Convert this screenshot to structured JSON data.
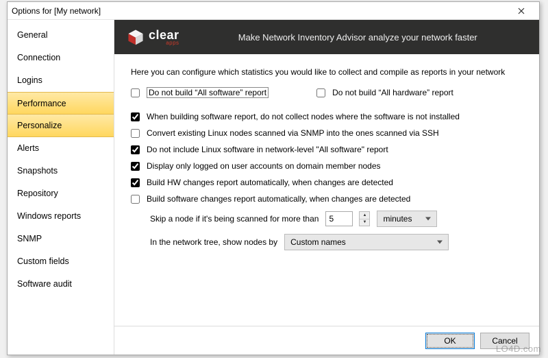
{
  "window": {
    "title": "Options for [My network]"
  },
  "sidebar": {
    "items": [
      {
        "label": "General",
        "selected": false
      },
      {
        "label": "Connection",
        "selected": false
      },
      {
        "label": "Logins",
        "selected": false
      },
      {
        "label": "Performance",
        "selected": true
      },
      {
        "label": "Personalize",
        "selected": true
      },
      {
        "label": "Alerts",
        "selected": false
      },
      {
        "label": "Snapshots",
        "selected": false
      },
      {
        "label": "Repository",
        "selected": false
      },
      {
        "label": "Windows reports",
        "selected": false
      },
      {
        "label": "SNMP",
        "selected": false
      },
      {
        "label": "Custom fields",
        "selected": false
      },
      {
        "label": "Software audit",
        "selected": false
      }
    ]
  },
  "banner": {
    "brand": "clear",
    "brand_sub": "apps",
    "tagline": "Make Network Inventory Advisor analyze your network faster"
  },
  "pane": {
    "description": "Here you can configure which statistics you would like to collect and compile as reports in your network",
    "opt_no_all_software": {
      "label": "Do not build “All software” report",
      "checked": false
    },
    "opt_no_all_hardware": {
      "label": "Do not  build “All hardware” report",
      "checked": false
    },
    "opt_skip_not_installed": {
      "label": "When building software report, do not collect nodes where the software is not installed",
      "checked": true
    },
    "opt_convert_linux": {
      "label": "Convert existing Linux nodes scanned via SNMP into the ones scanned via SSH",
      "checked": false
    },
    "opt_exclude_linux_sw": {
      "label": "Do not include Linux software in network-level \"All software\" report",
      "checked": true
    },
    "opt_logged_on_only": {
      "label": "Display only logged on user accounts on domain member nodes",
      "checked": true
    },
    "opt_hw_changes": {
      "label": "Build HW changes report automatically, when changes are detected",
      "checked": true
    },
    "opt_sw_changes": {
      "label": "Build software changes report automatically, when changes are detected",
      "checked": false
    },
    "skip_label": "Skip a node if it's being scanned for more than",
    "skip_value": "5",
    "skip_unit": "minutes",
    "show_by_label": "In the network tree, show nodes by",
    "show_by_value": "Custom names"
  },
  "footer": {
    "ok": "OK",
    "cancel": "Cancel"
  },
  "watermark": "LO4D.com"
}
